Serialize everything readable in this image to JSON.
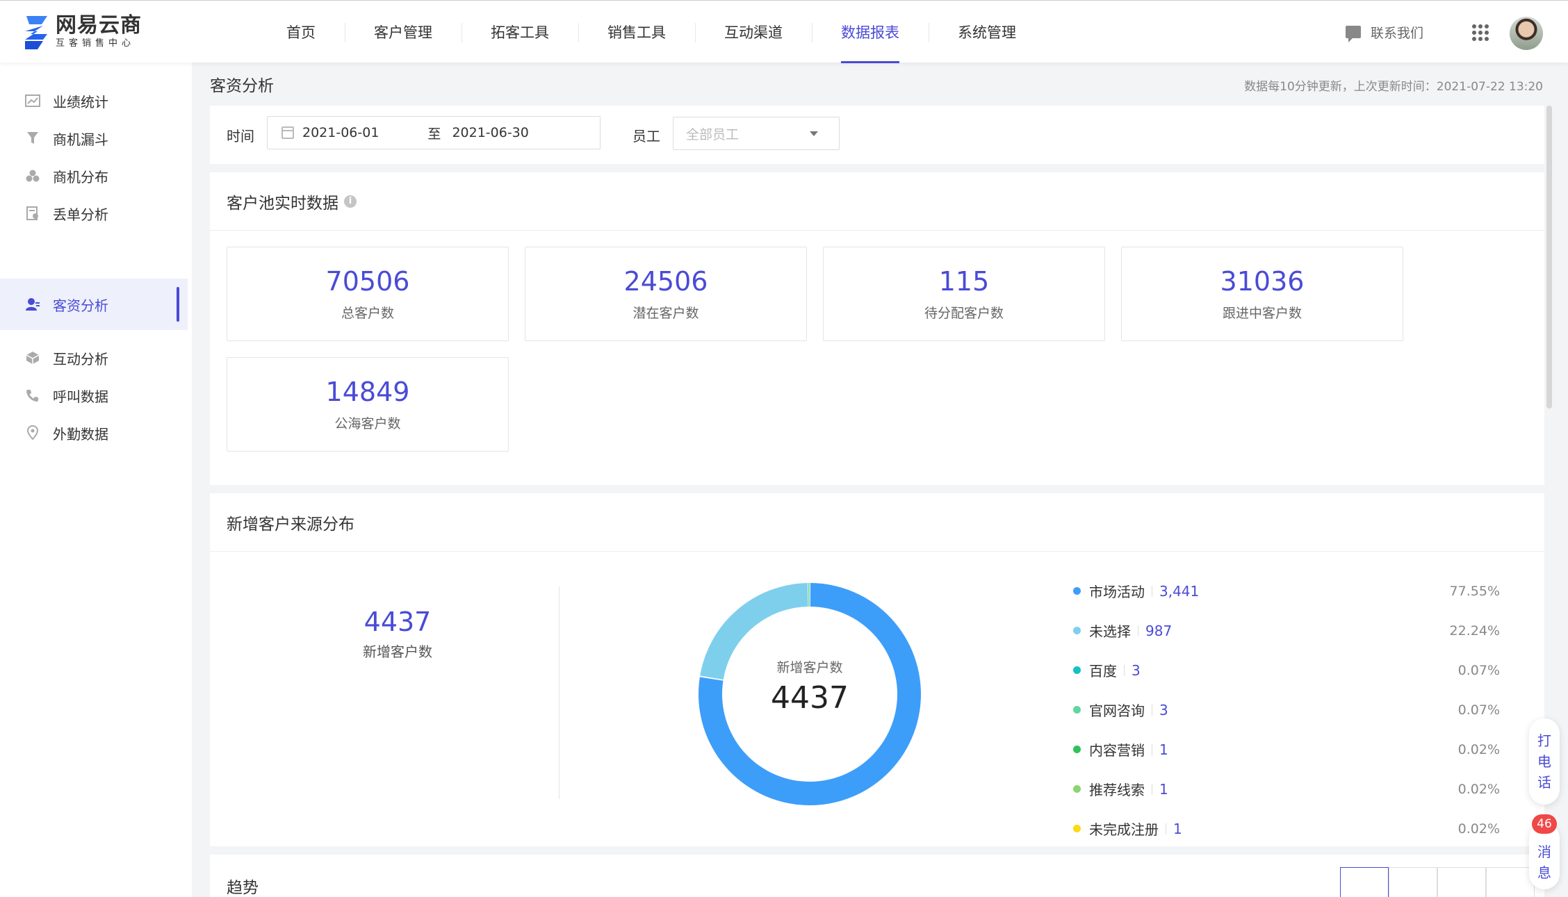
{
  "logo": {
    "title": "网易云商",
    "subtitle": "互客销售中心"
  },
  "nav": [
    "首页",
    "客户管理",
    "拓客工具",
    "销售工具",
    "互动渠道",
    "数据报表",
    "系统管理"
  ],
  "nav_active": "数据报表",
  "header": {
    "contact": "联系我们"
  },
  "sidebar": [
    {
      "label": "业绩统计",
      "icon": "chart-line-icon"
    },
    {
      "label": "商机漏斗",
      "icon": "funnel-icon"
    },
    {
      "label": "商机分布",
      "icon": "cluster-icon"
    },
    {
      "label": "丢单分析",
      "icon": "document-icon"
    },
    {
      "label": "客资分析",
      "icon": "user-icon",
      "active": true
    },
    {
      "label": "互动分析",
      "icon": "cube-icon"
    },
    {
      "label": "呼叫数据",
      "icon": "phone-icon"
    },
    {
      "label": "外勤数据",
      "icon": "location-pin-icon"
    }
  ],
  "page": {
    "title": "客资分析",
    "update_note": "数据每10分钟更新，上次更新时间：2021-07-22 13:20"
  },
  "filters": {
    "time_label": "时间",
    "date_start": "2021-06-01",
    "date_separator": "至",
    "date_end": "2021-06-30",
    "employee_label": "员工",
    "employee_placeholder": "全部员工"
  },
  "pool": {
    "title": "客户池实时数据",
    "info": "i",
    "stats": [
      {
        "value": "70506",
        "label": "总客户数"
      },
      {
        "value": "24506",
        "label": "潜在客户数"
      },
      {
        "value": "115",
        "label": "待分配客户数"
      },
      {
        "value": "31036",
        "label": "跟进中客户数"
      },
      {
        "value": "14849",
        "label": "公海客户数"
      }
    ]
  },
  "source": {
    "title": "新增客户来源分布",
    "total_value": "4437",
    "total_label": "新增客户数",
    "donut_label": "新增客户数",
    "donut_value": "4437"
  },
  "chart_data": {
    "type": "pie",
    "donut": true,
    "categories": [
      "市场活动",
      "未选择",
      "百度",
      "官网咨询",
      "内容营销",
      "推荐线索",
      "未完成注册"
    ],
    "values": [
      3441,
      987,
      3,
      3,
      1,
      1,
      1
    ],
    "value_labels": [
      "3,441",
      "987",
      "3",
      "3",
      "1",
      "1",
      "1"
    ],
    "percentages": [
      "77.55%",
      "22.24%",
      "0.07%",
      "0.07%",
      "0.02%",
      "0.02%",
      "0.02%"
    ],
    "colors": [
      "#3d9ef9",
      "#7ecfec",
      "#13c2c2",
      "#5fd7a0",
      "#2fc25b",
      "#8bd46e",
      "#fadb14"
    ],
    "legend_position": "right",
    "center_label": "新增客户数",
    "center_value": "4437"
  },
  "float": {
    "call": [
      "打",
      "电",
      "话"
    ],
    "message": [
      "消",
      "息"
    ],
    "badge": "46"
  },
  "next_section": {
    "title": "趋势"
  }
}
